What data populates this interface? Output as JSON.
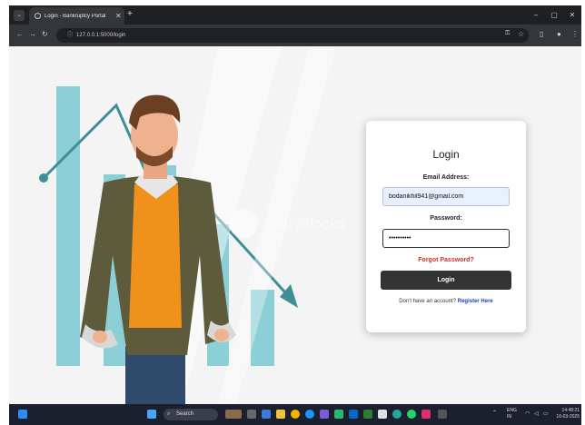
{
  "browser": {
    "tab_title": "Login - Bankruptcy Portal",
    "tab_close": "✕",
    "new_tab": "+",
    "url": "127.0.0.1:5000/login",
    "window_controls": [
      "–",
      "▢",
      "✕"
    ]
  },
  "watermark": "Storyblocks",
  "login": {
    "title": "Login",
    "email_label": "Email Address:",
    "email_value": "bodanikhil941@gmail.com",
    "password_label": "Password:",
    "password_value": "••••••••••",
    "forgot": "Forgot Password?",
    "button": "Login",
    "no_account": "Don't have an account? ",
    "register": "Register Here"
  },
  "taskbar": {
    "search_placeholder": "Search",
    "lang_top": "ENG",
    "lang_bottom": "IN",
    "time": "14:48:21",
    "date": "16-03-2025"
  },
  "colors": {
    "accent_button": "#333333",
    "forgot_link": "#d0302b",
    "register_link": "#1d3fb8",
    "chart_bars": "#8ccfd6"
  }
}
